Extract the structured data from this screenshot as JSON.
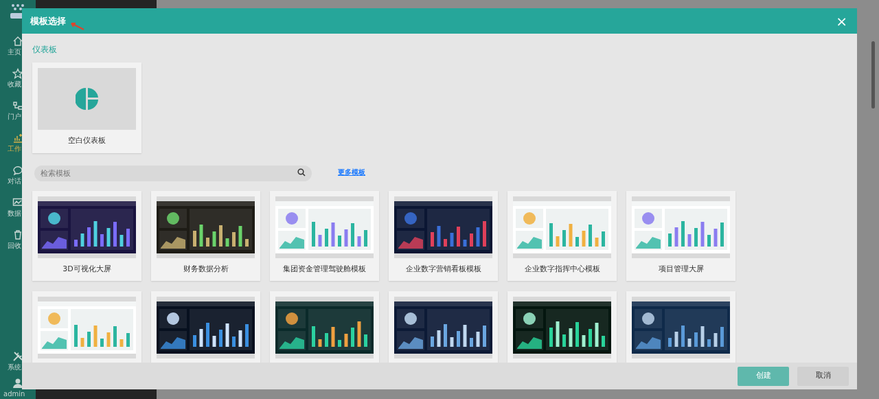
{
  "sidebar": {
    "items": [
      {
        "label": "主页",
        "kind": "home"
      },
      {
        "label": "收藏",
        "kind": "star"
      },
      {
        "label": "门户",
        "kind": "portal"
      },
      {
        "label": "工作",
        "kind": "chart"
      },
      {
        "label": "对话",
        "kind": "chat"
      },
      {
        "label": "数据",
        "kind": "monitor"
      },
      {
        "label": "回收",
        "kind": "trash"
      }
    ],
    "bottom_items": [
      {
        "label": "系统",
        "kind": "tools"
      },
      {
        "label": "admin",
        "kind": "user"
      }
    ]
  },
  "dialog": {
    "title": "模板选择",
    "close": "×",
    "section": "仪表板",
    "blank_card": {
      "label": "空白仪表板"
    },
    "search": {
      "placeholder": "检索模板"
    },
    "more_link": "更多模板",
    "templates": [
      {
        "label": "3D可视化大屏",
        "kind": "picture"
      },
      {
        "label": "财务数据分析",
        "kind": "picture"
      },
      {
        "label": "集团资金管理驾驶舱模板",
        "kind": "picture"
      },
      {
        "label": "企业数字营销看板模板",
        "kind": "picture"
      },
      {
        "label": "企业数字指挥中心模板",
        "kind": "picture"
      },
      {
        "label": "项目管理大屏",
        "kind": "picture"
      },
      {
        "kind": "picture"
      },
      {
        "kind": "picture"
      },
      {
        "kind": "picture"
      },
      {
        "kind": "picture"
      },
      {
        "kind": "picture"
      },
      {
        "kind": "picture"
      }
    ],
    "buttons": [
      {
        "label": "创建",
        "kind": "primary"
      },
      {
        "label": "取消",
        "kind": "secondary"
      }
    ]
  }
}
